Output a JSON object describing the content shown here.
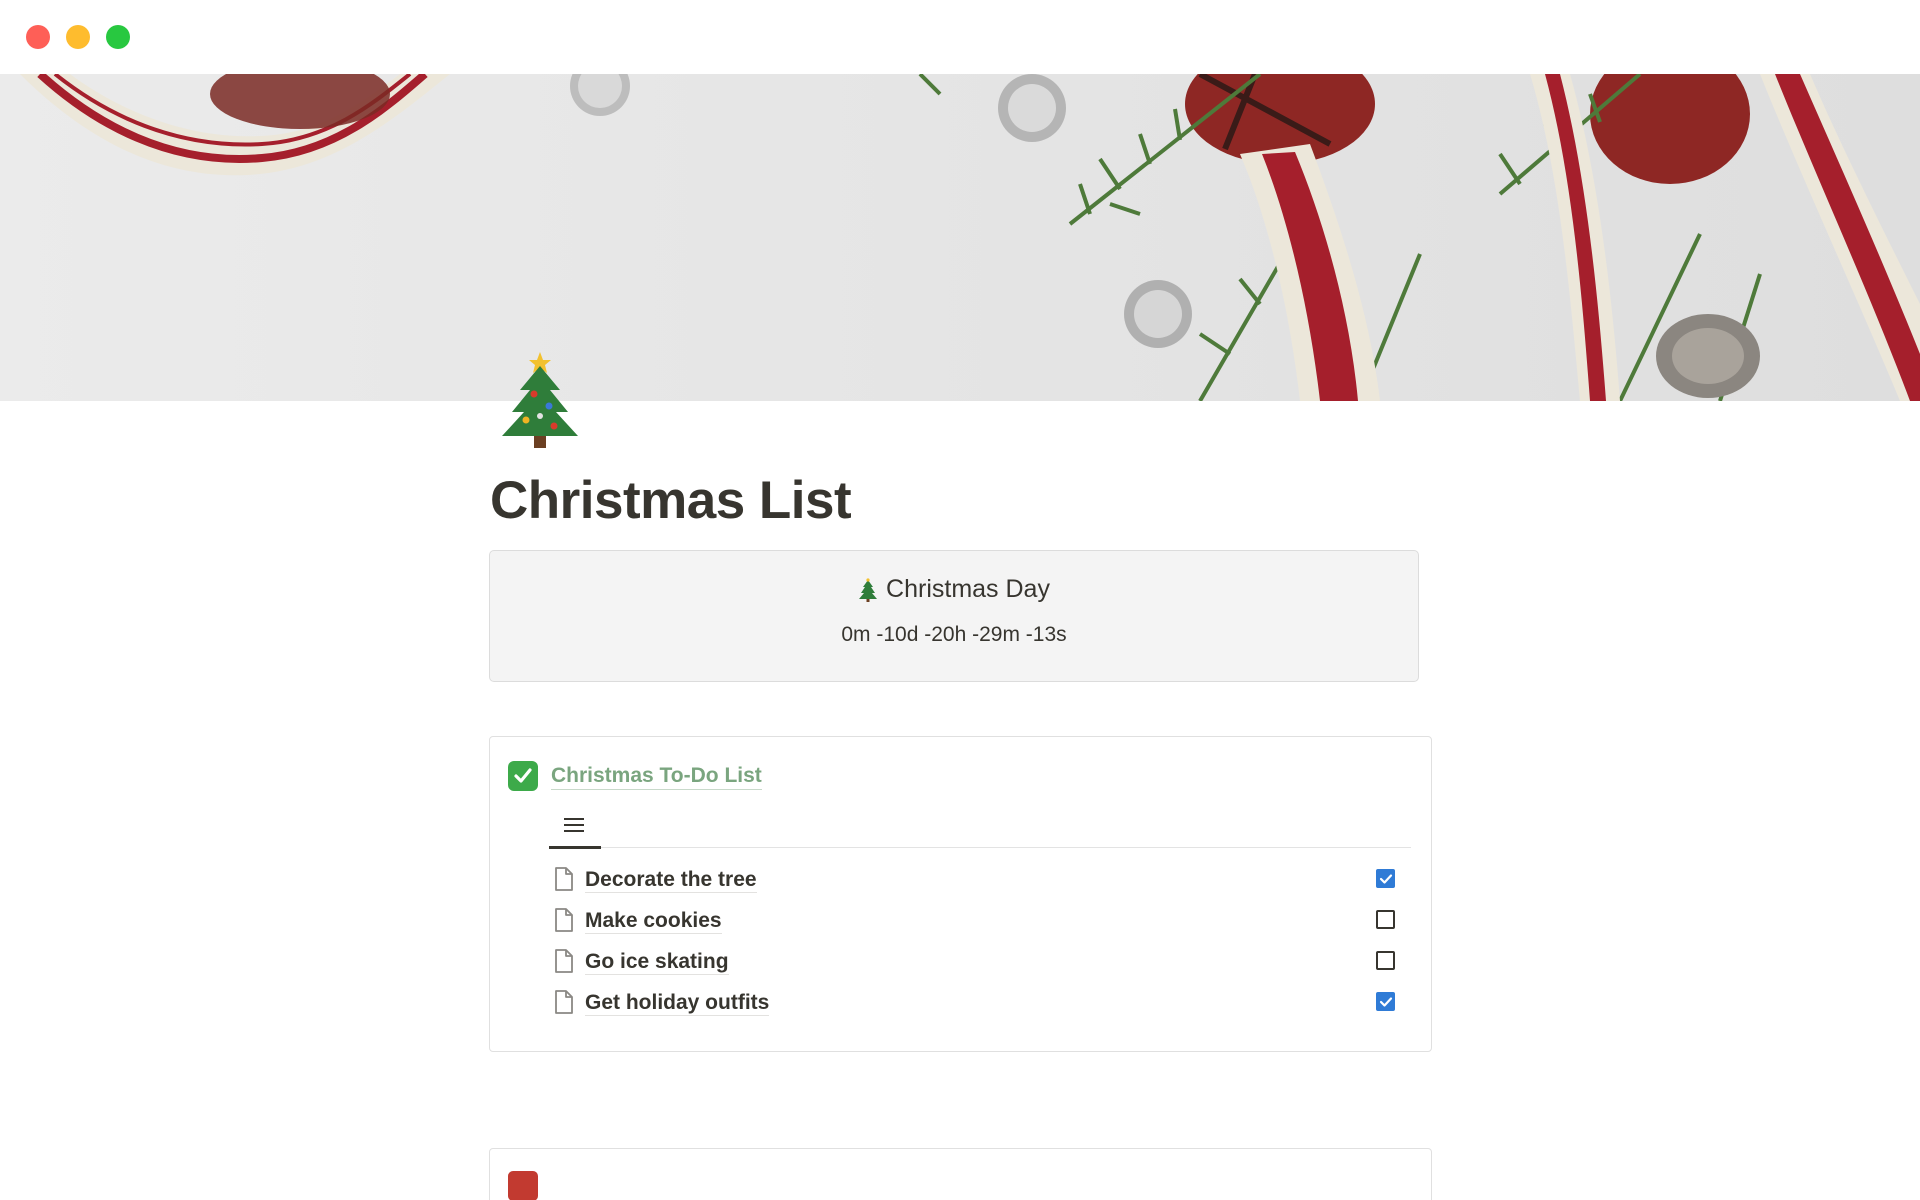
{
  "window": {
    "controls": [
      "close",
      "minimize",
      "zoom"
    ]
  },
  "page": {
    "icon": "christmas-tree-icon",
    "title": "Christmas List"
  },
  "countdown": {
    "icon": "christmas-tree-icon",
    "title": "Christmas Day",
    "remaining": "0m -10d -20h -29m -13s"
  },
  "todo_database": {
    "icon": "check-mark-button-icon",
    "title": "Christmas To-Do List",
    "view_icon": "list-view-icon",
    "rows": [
      {
        "label": "Decorate the tree",
        "done": true
      },
      {
        "label": "Make cookies",
        "done": false
      },
      {
        "label": "Go ice skating",
        "done": false
      },
      {
        "label": "Get holiday outfits",
        "done": true
      }
    ]
  },
  "gift_database": {
    "icon": "wrapped-gift-icon",
    "title": ""
  },
  "colors": {
    "accent_checkbox": "#2f7bd6",
    "database_title": "#7aa57f",
    "check_icon_bg": "#3daa4a",
    "ribbon_red": "#a51f2c"
  }
}
